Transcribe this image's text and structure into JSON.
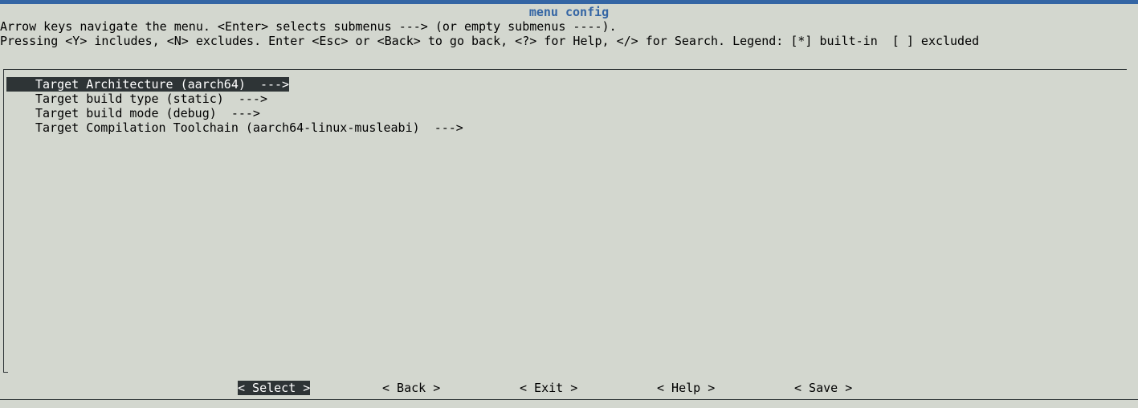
{
  "header": {
    "title": "menu config",
    "help_line_1": "Arrow keys navigate the menu. <Enter> selects submenus ---> (or empty submenus ----).",
    "help_line_2": "Pressing <Y> includes, <N> excludes. Enter <Esc> or <Back> to go back, <?> for Help, </> for Search. Legend: [*] built-in  [ ] excluded"
  },
  "menu": {
    "items": [
      {
        "label": "Target Architecture (aarch64)  --->",
        "selected": true
      },
      {
        "label": "Target build type (static)  --->",
        "selected": false
      },
      {
        "label": "Target build mode (debug)  --->",
        "selected": false
      },
      {
        "label": "Target Compilation Toolchain (aarch64-linux-musleabi)  --->",
        "selected": false
      }
    ]
  },
  "buttons": {
    "select": "< Select >",
    "back": "< Back >",
    "exit": "< Exit >",
    "help": "< Help >",
    "save": "< Save >",
    "selected": "select"
  },
  "colors": {
    "background": "#d3d7cf",
    "accent": "#3465a4",
    "highlight_bg": "#2e3436",
    "highlight_fg": "#ffffff"
  }
}
